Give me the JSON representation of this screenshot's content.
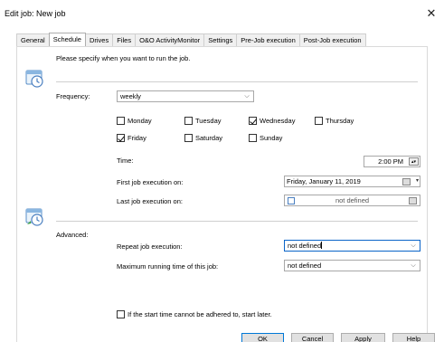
{
  "window": {
    "title": "Edit job: New job"
  },
  "tabs": [
    {
      "label": "General"
    },
    {
      "label": "Schedule"
    },
    {
      "label": "Drives"
    },
    {
      "label": "Files"
    },
    {
      "label": "O&O ActivityMonitor"
    },
    {
      "label": "Settings"
    },
    {
      "label": "Pre-Job execution"
    },
    {
      "label": "Post-Job execution"
    }
  ],
  "schedule": {
    "intro": "Please specify when you want to run the job.",
    "frequency_label": "Frequency:",
    "frequency_value": "weekly",
    "days": [
      {
        "label": "Monday",
        "checked": false
      },
      {
        "label": "Tuesday",
        "checked": false
      },
      {
        "label": "Wednesday",
        "checked": true
      },
      {
        "label": "Thursday",
        "checked": false
      },
      {
        "label": "Friday",
        "checked": true
      },
      {
        "label": "Saturday",
        "checked": false
      },
      {
        "label": "Sunday",
        "checked": false
      }
    ],
    "time_label": "Time:",
    "time_value": "2:00 PM",
    "first_label": "First job execution on:",
    "first_value": "Friday, January 11, 2019",
    "last_label": "Last job execution on:",
    "last_value": "not defined"
  },
  "advanced": {
    "label": "Advanced:",
    "repeat_label": "Repeat job execution:",
    "repeat_value": "not defined",
    "maxtime_label": "Maximum running time of this job:",
    "maxtime_value": "not defined",
    "start_later_label": "If the start time cannot be adhered to, start later.",
    "start_later_checked": false
  },
  "buttons": {
    "ok": "OK",
    "cancel": "Cancel",
    "apply": "Apply",
    "help": "Help"
  },
  "icons": {
    "close": "close-icon",
    "schedule": "calendar-clock-icon",
    "advanced": "calendar-clock-repeat-icon"
  }
}
